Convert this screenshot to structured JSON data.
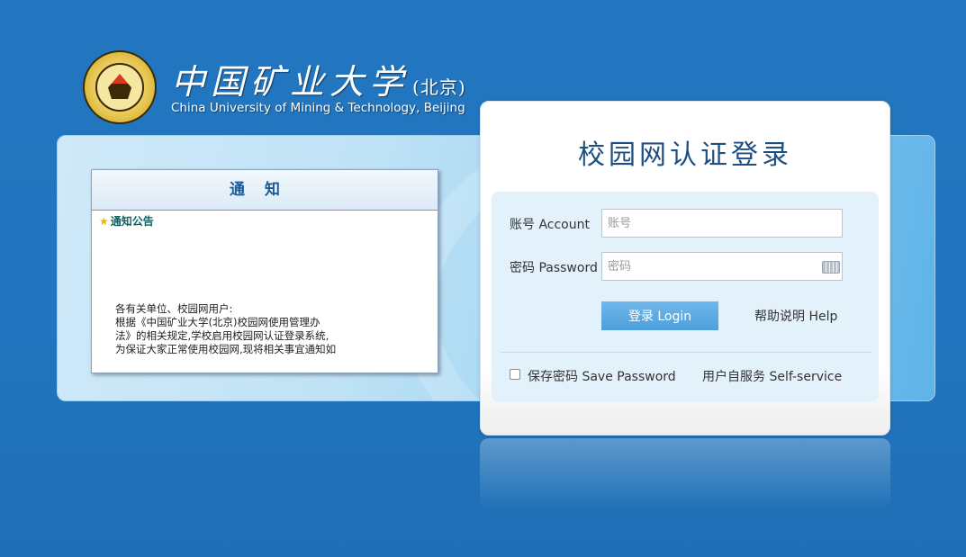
{
  "header": {
    "name_cn": "中国矿业大学",
    "name_cn_suffix": "(北京)",
    "name_en": "China University of Mining & Technology, Beijing"
  },
  "notice": {
    "title": "通知",
    "subtitle": "通知公告",
    "body": [
      "各有关单位、校园网用户:",
      "根据《中国矿业大学(北京)校园网使用管理办",
      "法》的相关规定,学校启用校园网认证登录系统,",
      "为保证大家正常使用校园网,现将相关事宜通知如"
    ]
  },
  "login": {
    "title": "校园网认证登录",
    "account_label": "账号 Account",
    "account_placeholder": "账号",
    "password_label": "密码 Password",
    "password_placeholder": "密码",
    "login_button": "登录 Login",
    "help_link": "帮助说明  Help",
    "save_password": "保存密码 Save Password",
    "self_service": "用户自服务 Self-service"
  },
  "colors": {
    "background": "#2174bd",
    "title": "#1f4f80",
    "button": "#5aa9e2"
  }
}
